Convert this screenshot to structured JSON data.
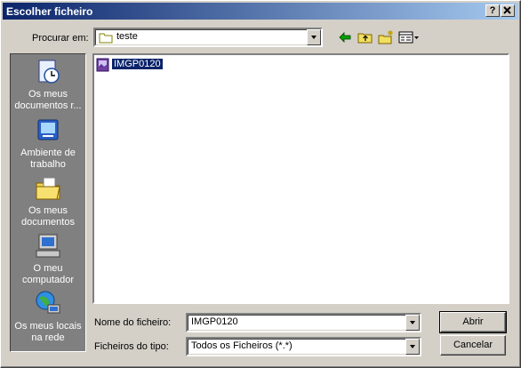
{
  "window": {
    "title": "Escolher ficheiro",
    "help_label": "?",
    "close_label": "✕"
  },
  "toolbar": {
    "look_in_label": "Procurar em:",
    "look_in_value": "teste",
    "back_icon": "back-arrow-icon",
    "up_icon": "up-folder-icon",
    "new_folder_icon": "new-folder-icon",
    "view_icon": "view-menu-icon"
  },
  "places": [
    {
      "label": "Os meus documentos r...",
      "icon": "recent-documents-icon"
    },
    {
      "label": "Ambiente de trabalho",
      "icon": "desktop-icon"
    },
    {
      "label": "Os meus documentos",
      "icon": "my-documents-icon"
    },
    {
      "label": "O meu computador",
      "icon": "my-computer-icon"
    },
    {
      "label": "Os meus locais na rede",
      "icon": "network-places-icon"
    }
  ],
  "files": [
    {
      "name": "IMGP0120",
      "icon": "image-file-icon",
      "selected": true
    }
  ],
  "form": {
    "filename_label": "Nome do ficheiro:",
    "filename_value": "IMGP0120",
    "filetype_label": "Ficheiros do tipo:",
    "filetype_value": "Todos os Ficheiros (*.*)"
  },
  "buttons": {
    "open": "Abrir",
    "cancel": "Cancelar"
  },
  "colors": {
    "title_start": "#0a246a",
    "title_end": "#a6caf0",
    "face": "#d4d0c8",
    "places_bg": "#808080",
    "selection": "#0a246a"
  }
}
